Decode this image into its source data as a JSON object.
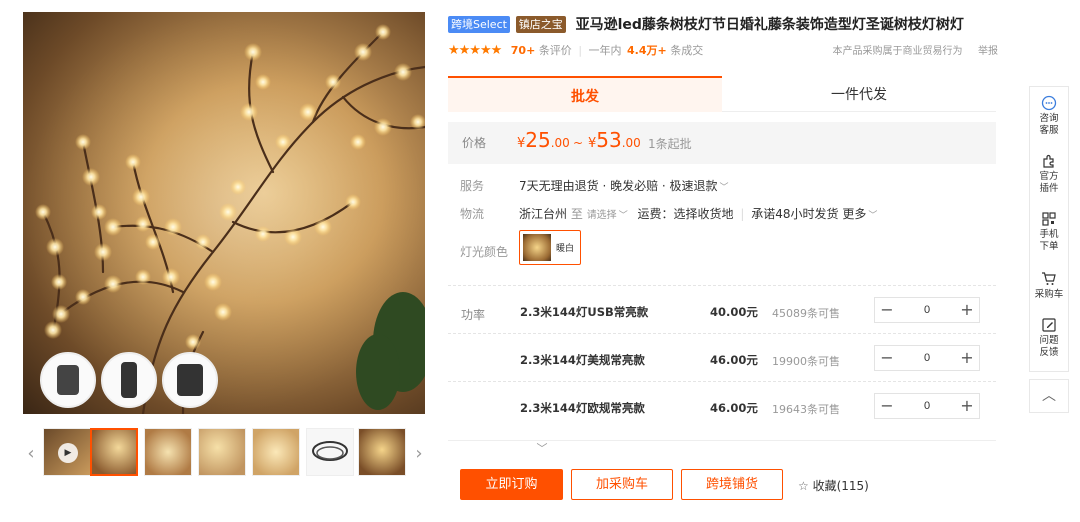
{
  "product": {
    "tags": [
      "跨境Select",
      "镇店之宝"
    ],
    "title": "亚马逊led藤条树枝灯节日婚礼藤条装饰造型灯圣诞树枝灯树灯"
  },
  "rating": {
    "stars": "★★★★★",
    "reviews_count": "70+",
    "reviews_label": "条评价",
    "sep": "|",
    "year_label": "一年内",
    "sold": "4.4万+",
    "sold_label": "条成交",
    "notice": "本产品采购属于商业贸易行为",
    "report": "举报"
  },
  "tabs": {
    "wholesale": "批发",
    "dropship": "一件代发"
  },
  "price": {
    "label": "价格",
    "low_cur": "¥",
    "low_int": "25",
    "low_dec": ".00",
    "tilde": "~",
    "high_cur": "¥",
    "high_int": "53",
    "high_dec": ".00",
    "moq": "1条起批"
  },
  "service": {
    "label": "服务",
    "value": "7天无理由退货 · 晚发必赔 · 极速退款"
  },
  "logistics": {
    "label": "物流",
    "origin": "浙江台州",
    "to": "至",
    "select_placeholder": "请选择",
    "shipping": "运费：选择收货地",
    "promise": "承诺48小时发货",
    "more": "更多"
  },
  "light_color": {
    "label": "灯光颜色",
    "option": "暖白"
  },
  "power": {
    "label": "功率",
    "skus": [
      {
        "name": "2.3米144灯USB常亮款",
        "price": "40.00元",
        "stock": "45089条可售",
        "qty": "0"
      },
      {
        "name": "2.3米144灯美规常亮款",
        "price": "46.00元",
        "stock": "19900条可售",
        "qty": "0"
      },
      {
        "name": "2.3米144灯欧规常亮款",
        "price": "46.00元",
        "stock": "19643条可售",
        "qty": "0"
      }
    ]
  },
  "actions": {
    "buy_now": "立即订购",
    "add_cart": "加采购车",
    "cross_border": "跨境铺货",
    "favorite": "收藏(115)"
  },
  "sidebar": {
    "consult": [
      "咨询",
      "客服"
    ],
    "plugin": [
      "官方",
      "插件"
    ],
    "mobile": [
      "手机",
      "下单"
    ],
    "cart": "采购车",
    "feedback": [
      "问题",
      "反馈"
    ]
  },
  "colors": {
    "accent": "#ff5000",
    "tag_blue": "#4b8bf5",
    "tag_brown": "#8b5a2b"
  },
  "icons": [
    "play-icon",
    "chevron-left-icon",
    "chevron-right-icon",
    "star-icon",
    "chevron-down-icon",
    "chat-icon",
    "puzzle-icon",
    "qrcode-icon",
    "cart-icon",
    "edit-icon",
    "chevron-up-icon"
  ]
}
